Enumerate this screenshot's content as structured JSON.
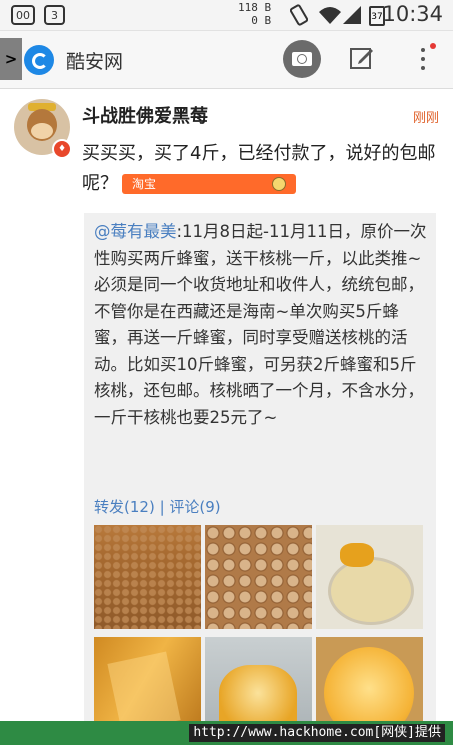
{
  "status_bar": {
    "left_badges": [
      "00",
      "3"
    ],
    "net_up": "118 B",
    "net_down": "0 B",
    "battery": "37",
    "time": "10:34"
  },
  "app_bar": {
    "side_tab": ">",
    "title": "酷安网",
    "icons": [
      "coolapk-logo-icon",
      "camera-icon",
      "edit-icon",
      "more-icon"
    ]
  },
  "post": {
    "username": "斗战胜佛爱黑莓",
    "time": "刚刚",
    "text": "买买买，买了4斤，已经付款了，说好的包邮呢？",
    "tag": "淘宝",
    "repost": {
      "mention": "@莓有最美",
      "text": ":11月8日起-11月11日，原价一次性购买两斤蜂蜜，送干核桃一斤，以此类推~必须是同一个收货地址和收件人，统统包邮，不管你是在西藏还是海南~单次购买5斤蜂蜜，再送一斤蜂蜜，同时享受赠送核桃的活动。比如买10斤蜂蜜，可另获2斤蜂蜜和5斤核桃，还包邮。核桃晒了一个月，不含水分，一斤干核桃也要25元了~",
      "forward": "转发(12)",
      "separator": " | ",
      "comment": "评论(9)",
      "images": [
        "walnuts-pile",
        "walnuts-closeup",
        "honey-bowl",
        "honey-block",
        "honey-jar",
        "honey-jar-top"
      ]
    }
  },
  "watermark": "http://www.hackhome.com[网侠]提供",
  "colors": {
    "accent": "#e0622b",
    "link": "#4a7fc0",
    "tag": "#ff6a2a",
    "footer": "#2e8b44"
  }
}
